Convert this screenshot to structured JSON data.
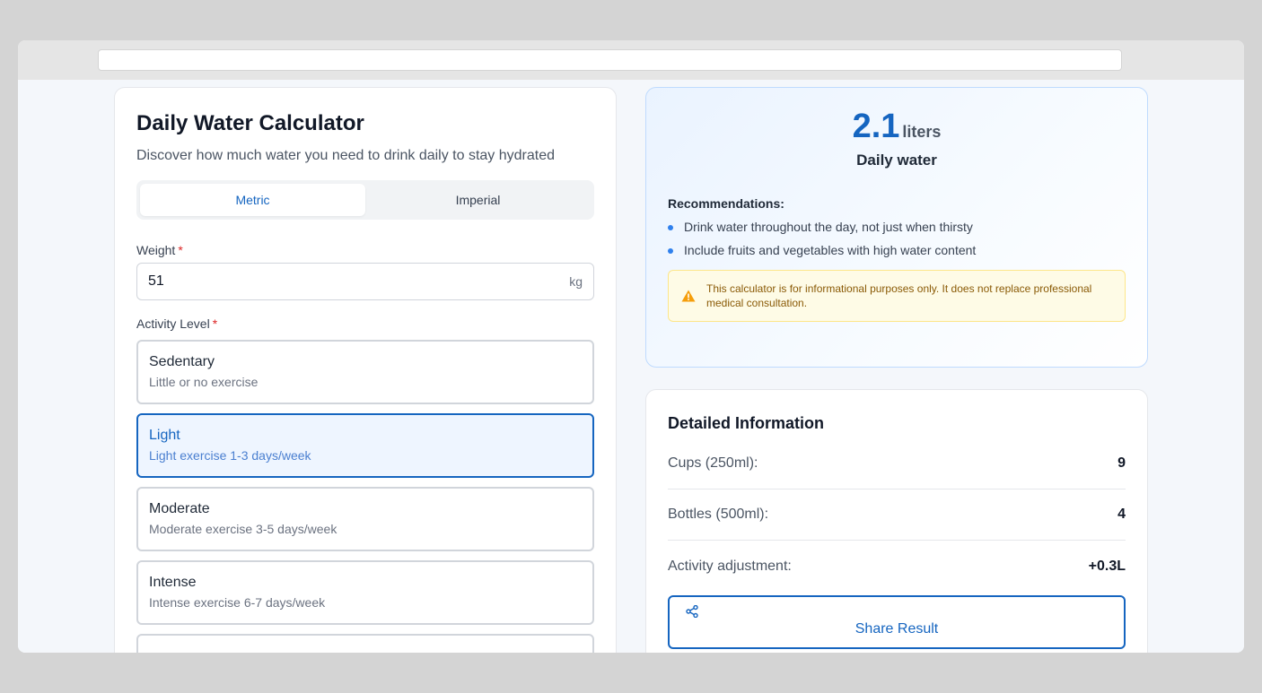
{
  "header": {
    "title": "Daily Water Calculator",
    "subtitle": "Discover how much water you need to drink daily to stay hydrated"
  },
  "units": {
    "tabs": [
      {
        "label": "Metric",
        "active": true
      },
      {
        "label": "Imperial",
        "active": false
      }
    ]
  },
  "weight": {
    "label": "Weight",
    "required_mark": "*",
    "value": "51",
    "unit": "kg"
  },
  "activity": {
    "label": "Activity Level",
    "required_mark": "*",
    "options": [
      {
        "title": "Sedentary",
        "desc": "Little or no exercise",
        "selected": false
      },
      {
        "title": "Light",
        "desc": "Light exercise 1-3 days/week",
        "selected": true
      },
      {
        "title": "Moderate",
        "desc": "Moderate exercise 3-5 days/week",
        "selected": false
      },
      {
        "title": "Intense",
        "desc": "Intense exercise 6-7 days/week",
        "selected": false
      }
    ]
  },
  "result": {
    "amount": "2.1",
    "unit": "liters",
    "caption": "Daily water",
    "recommendations_title": "Recommendations:",
    "recommendations": [
      "Drink water throughout the day, not just when thirsty",
      "Include fruits and vegetables with high water content"
    ],
    "warning_icon": "warning-triangle-icon",
    "warning": "This calculator is for informational purposes only. It does not replace professional medical consultation."
  },
  "details": {
    "title": "Detailed Information",
    "rows": [
      {
        "label": "Cups (250ml):",
        "value": "9"
      },
      {
        "label": "Bottles (500ml):",
        "value": "4"
      },
      {
        "label": "Activity adjustment:",
        "value": "+0.3L"
      }
    ],
    "share_icon": "share-icon",
    "share_label": "Share Result"
  },
  "colors": {
    "accent": "#1565c0",
    "required": "#dc2626",
    "warning_bg": "#fefbe6",
    "warning_text": "#8a5a06"
  }
}
